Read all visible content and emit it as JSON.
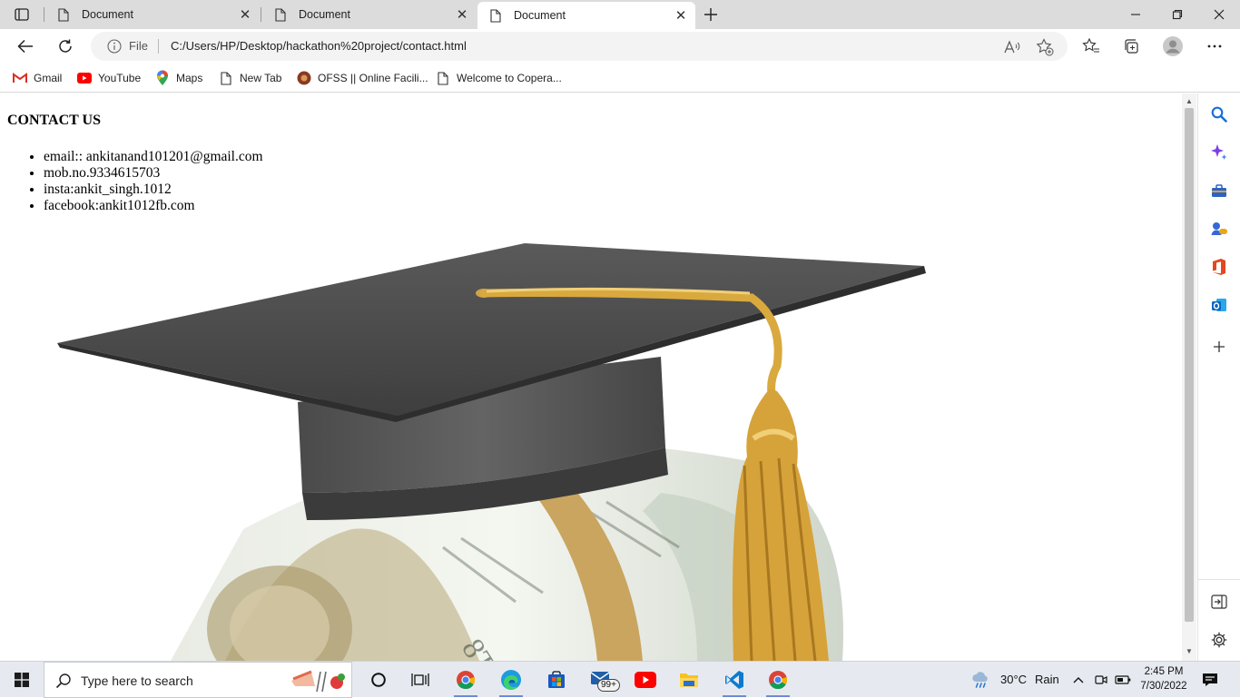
{
  "browser": {
    "tabs": [
      {
        "title": "Document",
        "active": false
      },
      {
        "title": "Document",
        "active": false
      },
      {
        "title": "Document",
        "active": true
      }
    ],
    "address": {
      "scheme_label": "File",
      "url": "C:/Users/HP/Desktop/hackathon%20project/contact.html"
    },
    "favorites": [
      {
        "label": "Gmail",
        "icon": "gmail-icon"
      },
      {
        "label": "YouTube",
        "icon": "youtube-icon"
      },
      {
        "label": "Maps",
        "icon": "maps-icon"
      },
      {
        "label": "New Tab",
        "icon": "page-icon"
      },
      {
        "label": "OFSS || Online Facili...",
        "icon": "ofss-icon"
      },
      {
        "label": "Welcome to Copera...",
        "icon": "page-icon"
      }
    ]
  },
  "page": {
    "title": "CONTACT US",
    "contacts": [
      "email:: ankitanand101201@gmail.com",
      "mob.no.9334615703",
      "insta:ankit_singh.1012",
      "facebook:ankit1012fb.com"
    ],
    "image": "graduation-cap-on-money-roll"
  },
  "taskbar": {
    "search_placeholder": "Type here to search",
    "mail_badge": "99+",
    "weather": {
      "temp": "30°C",
      "condition": "Rain"
    },
    "time": "2:45 PM",
    "date": "7/30/2022"
  },
  "colors": {
    "tabstrip": "#dcdcdc",
    "omnibox": "#f3f3f3",
    "taskbar": "#e6eaf0",
    "accent": "#0067c0"
  }
}
